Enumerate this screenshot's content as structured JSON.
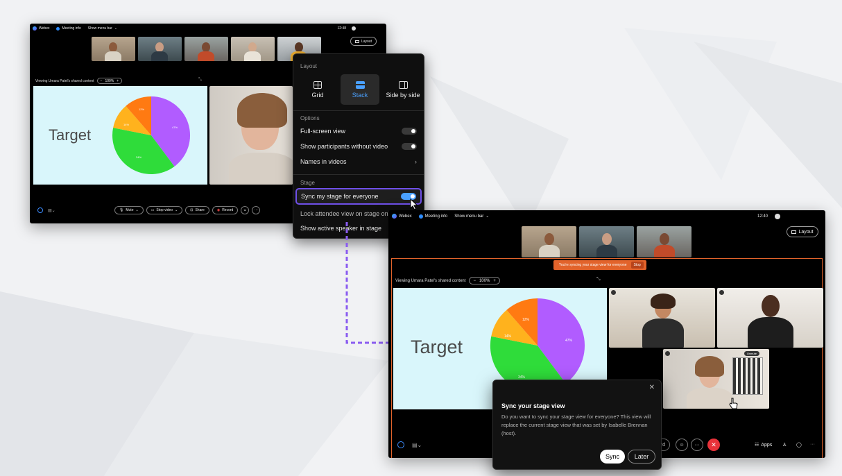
{
  "small_window": {
    "titlebar": {
      "app_name": "Webex",
      "meeting_info": "Meeting info",
      "menu_bar": "Show menu bar",
      "time": "12:48"
    },
    "layout_button": "Layout",
    "viewing_label": "Viewing Umara Patel's shared content",
    "zoom": "100%",
    "slide": {
      "title": "Target",
      "labels": [
        "12%",
        "14%",
        "47%",
        "34%"
      ]
    },
    "controls": {
      "mute": "Mute",
      "stop_video": "Stop video",
      "share": "Share",
      "record": "Record"
    }
  },
  "layout_menu": {
    "section_layout": "Layout",
    "layouts": [
      {
        "label": "Grid",
        "icon": "grid-icon"
      },
      {
        "label": "Stack",
        "icon": "stack-icon"
      },
      {
        "label": "Side by side",
        "icon": "side-by-side-icon"
      }
    ],
    "selected_layout": "Stack",
    "section_options": "Options",
    "options": [
      {
        "label": "Full-screen view",
        "control": "toggle",
        "on": false
      },
      {
        "label": "Show participants without video",
        "control": "toggle",
        "on": false
      },
      {
        "label": "Names in videos",
        "control": "chevron"
      }
    ],
    "section_stage": "Stage",
    "stage_items": [
      {
        "label": "Sync my stage for everyone",
        "control": "toggle",
        "on": true
      },
      {
        "label": "Lock attendee view on stage only",
        "control": "none"
      },
      {
        "label": "Show active speaker in stage",
        "control": "none"
      }
    ]
  },
  "large_window": {
    "titlebar": {
      "app_name": "Webex",
      "meeting_info": "Meeting info",
      "menu_bar": "Show menu bar",
      "time": "12:40"
    },
    "layout_button": "Layout",
    "sync_banner": {
      "text": "You're syncing your stage view for everyone",
      "stop": "Stop"
    },
    "viewing_label": "Viewing Umara Patel's shared content",
    "zoom": "100%",
    "slide": {
      "title": "Target",
      "labels": [
        "12%",
        "14%",
        "47%",
        "34%"
      ]
    },
    "unmute_badge": "Unmute",
    "controls": {
      "record_partial": "rd",
      "apps": "Apps"
    }
  },
  "sync_dialog": {
    "title": "Sync your stage view",
    "body": "Do you want to sync your stage view for everyone? This view will replace the current stage view that was set by Isabelle Brennan (host).",
    "sync_button": "Sync",
    "later_button": "Later"
  },
  "colors": {
    "pie_purple": "#b15cff",
    "pie_green": "#2fdc3a",
    "pie_orange": "#ff7a12",
    "pie_yellow": "#ffb21d",
    "accent_blue": "#4aa1ff",
    "banner_orange": "#e2632b",
    "dash_purple": "#8a5cf0",
    "end_red": "#e8323a"
  }
}
